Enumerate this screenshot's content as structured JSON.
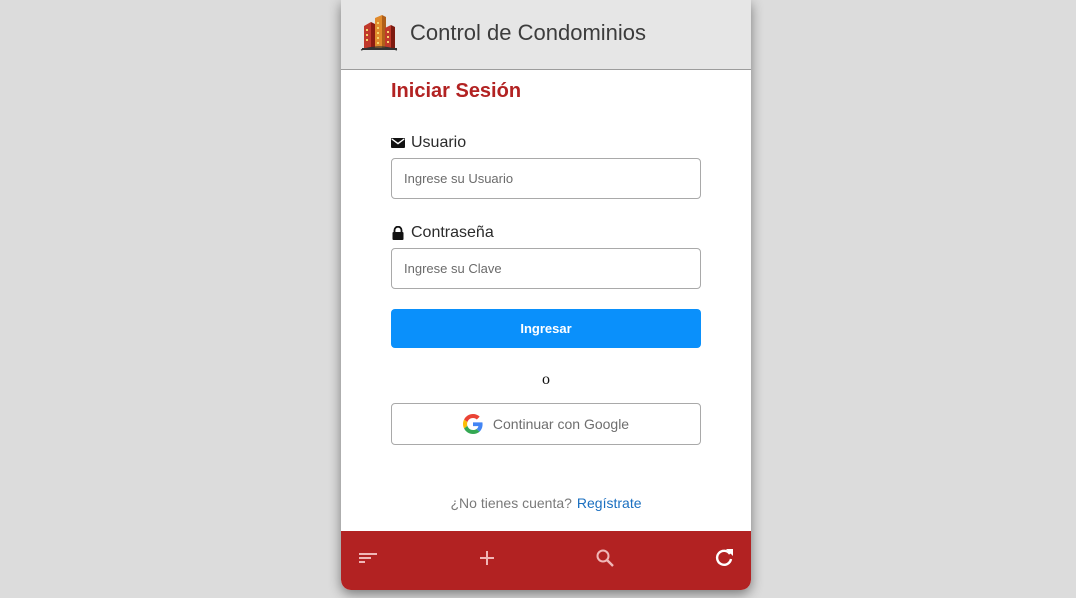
{
  "header": {
    "title": "Control de Condominios",
    "logo_icon": "condominium-buildings-logo"
  },
  "login": {
    "title": "Iniciar Sesión",
    "username": {
      "label": "Usuario",
      "icon": "envelope-icon",
      "placeholder": "Ingrese su Usuario",
      "value": ""
    },
    "password": {
      "label": "Contraseña",
      "icon": "lock-icon",
      "placeholder": "Ingrese su Clave",
      "value": ""
    },
    "submit_label": "Ingresar",
    "separator": "o",
    "google_label": "Continuar con Google",
    "register_question": "¿No tienes cuenta?",
    "register_link": "Regístrate"
  },
  "bottom_bar": {
    "items": [
      {
        "icon": "sort-icon"
      },
      {
        "icon": "plus-icon"
      },
      {
        "icon": "search-icon"
      },
      {
        "icon": "refresh-icon"
      }
    ]
  },
  "colors": {
    "accent_red": "#b22222",
    "primary_blue": "#0a90fb",
    "link_blue": "#1a6fc0",
    "header_bg": "#e6e6e6",
    "page_bg": "#dcdcdc"
  }
}
